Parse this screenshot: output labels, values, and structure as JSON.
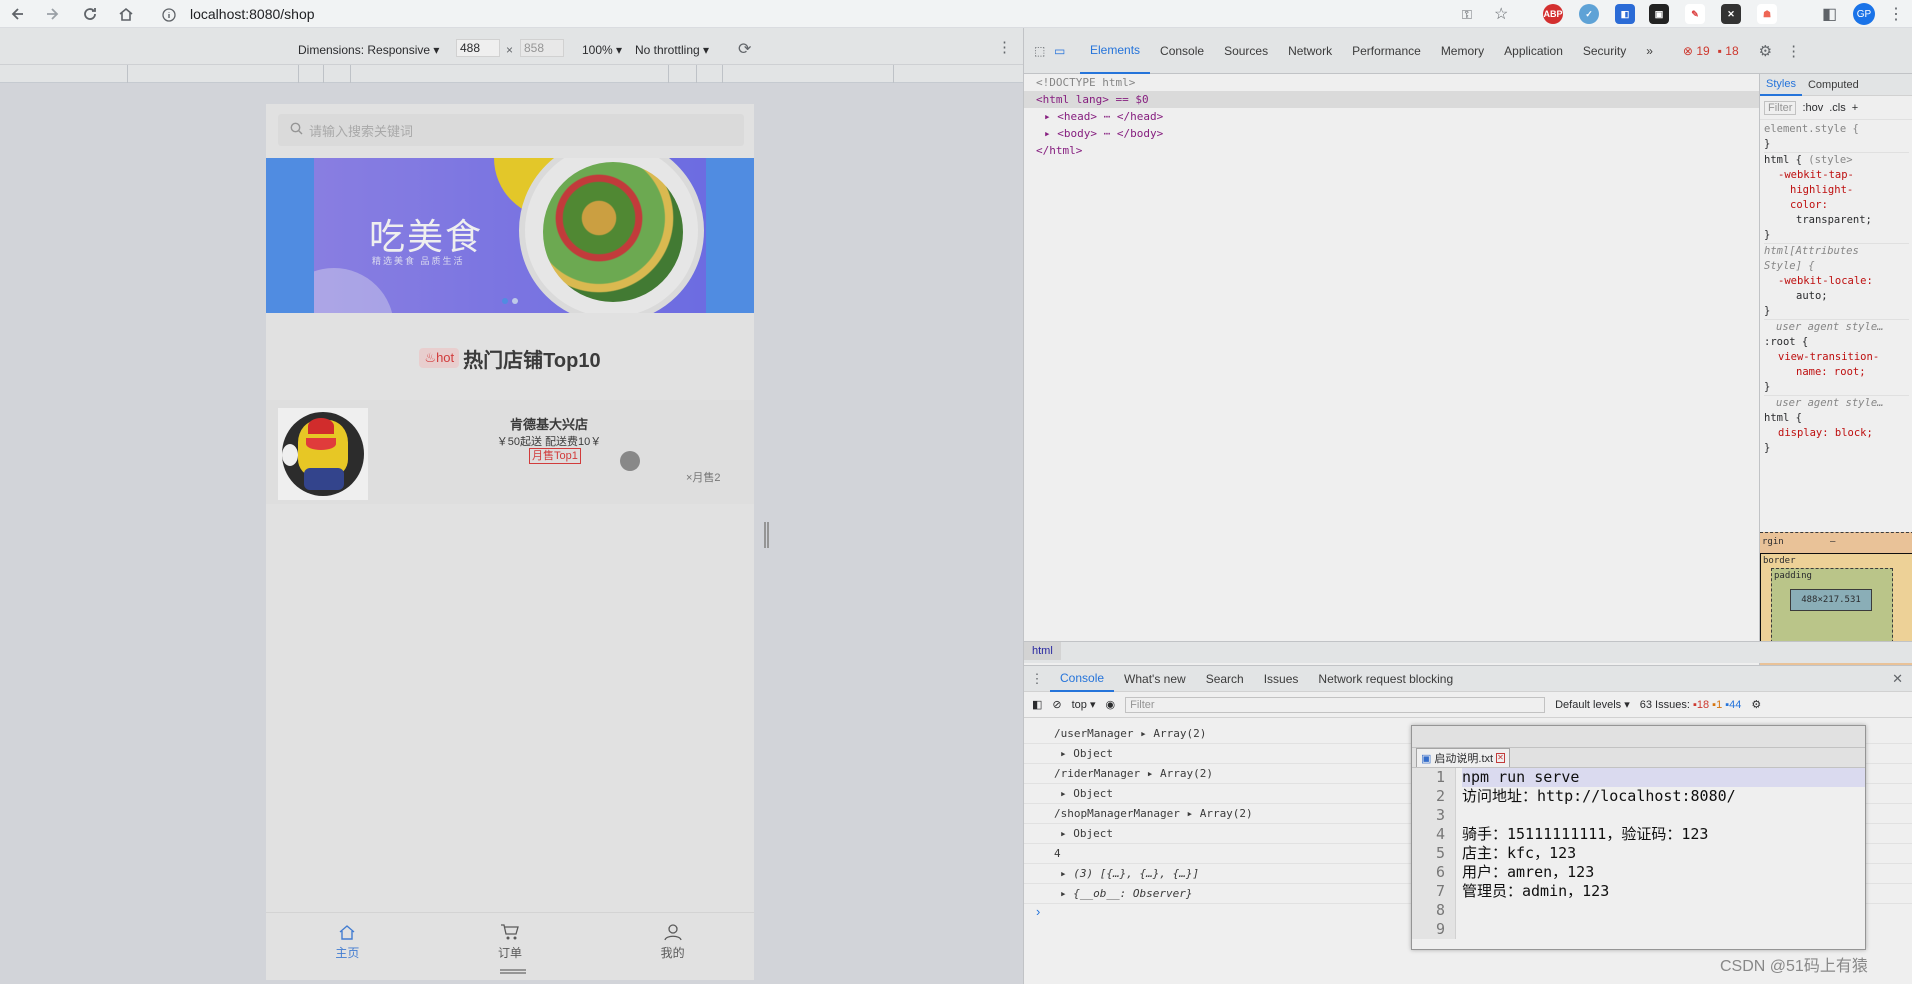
{
  "browser": {
    "url": "localhost:8080/shop",
    "back_icon": "arrow-left-icon",
    "forward_icon": "arrow-right-icon",
    "reload_icon": "reload-icon",
    "home_icon": "home-icon"
  },
  "device_toolbar": {
    "dimensions_label": "Dimensions: Responsive",
    "width": "488",
    "height": "858",
    "times": "×",
    "zoom": "100%",
    "throttling": "No throttling"
  },
  "app": {
    "search_placeholder": "请输入搜索关键词",
    "banner_title": "吃美食",
    "banner_subtitle": "精选美食  品质生活",
    "hot_badge": "hot",
    "hot_title": "热门店铺Top10",
    "shop": {
      "name": "肯德基大兴店",
      "delivery": "￥50起送  配送费10￥",
      "tag": "月售Top1",
      "sales": "×月售2"
    },
    "tabs": [
      {
        "label": "主页",
        "icon": "home-icon",
        "active": true
      },
      {
        "label": "订单",
        "icon": "cart-icon",
        "active": false
      },
      {
        "label": "我的",
        "icon": "user-icon",
        "active": false
      }
    ]
  },
  "devtools": {
    "tabs": [
      "Elements",
      "Console",
      "Sources",
      "Network",
      "Performance",
      "Memory",
      "Application",
      "Security"
    ],
    "more": "»",
    "errors": "19",
    "warnings": "18",
    "elements_lines": [
      "<!DOCTYPE html>",
      "<html lang> == $0",
      "<head> ⋯ </head>",
      "<body> ⋯ </body>",
      "</html>"
    ],
    "styles_tabs": [
      "Styles",
      "Computed"
    ],
    "filter_placeholder": "Filter",
    "hov": ":hov",
    "cls": ".cls",
    "styles_lines": [
      "element.style {",
      "}",
      "html {",
      "(style>",
      "-webkit-tap-",
      "highlight-",
      "color:",
      "transparent;",
      "}",
      "html[Attributes",
      "Style] {",
      "-webkit-locale:",
      "auto;",
      "}",
      "user agent style…",
      ":root {",
      "view-transition-",
      "name: root;",
      "}",
      "user agent style…",
      "html {",
      "display: block;",
      "}"
    ],
    "box_model": {
      "margin": "rgin",
      "border": "border",
      "padding": "padding",
      "dash": "–",
      "size": "488×217.531"
    },
    "breadcrumb": "html",
    "drawer_tabs": [
      "Console",
      "What's new",
      "Search",
      "Issues",
      "Network request blocking"
    ],
    "console_context": "top",
    "console_filter": "Filter",
    "default_levels": "Default levels",
    "issues_label": "63 Issues:",
    "issues_counts": [
      "18",
      "1",
      "44"
    ],
    "console_lines": [
      "/userManager  ▸ Array(2)",
      "▸ Object",
      "/riderManager  ▸ Array(2)",
      "▸ Object",
      "/shopManagerManager  ▸ Array(2)",
      "▸ Object",
      "4",
      "▸ (3) [{…}, {…}, {…}]",
      "▸ {__ob__: Observer}"
    ],
    "prompt": "›"
  },
  "notepad": {
    "tab_title": "启动说明.txt",
    "lines": [
      {
        "n": "1",
        "t": "npm run serve"
      },
      {
        "n": "2",
        "t": "访问地址：http://localhost:8080/"
      },
      {
        "n": "3",
        "t": ""
      },
      {
        "n": "4",
        "t": "骑手：15111111111，验证码：123"
      },
      {
        "n": "5",
        "t": "店主：kfc，123"
      },
      {
        "n": "6",
        "t": "用户：amren，123"
      },
      {
        "n": "7",
        "t": "管理员：admin，123"
      },
      {
        "n": "8",
        "t": ""
      },
      {
        "n": "9",
        "t": ""
      }
    ]
  },
  "watermark": "CSDN @51码上有猿"
}
